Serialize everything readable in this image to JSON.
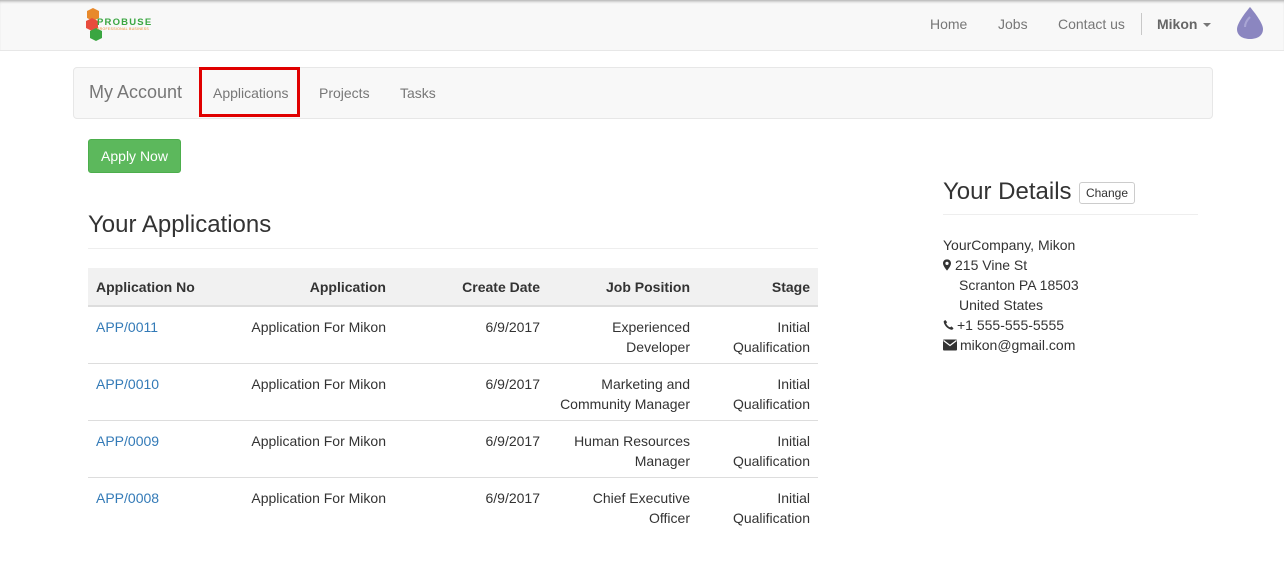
{
  "header": {
    "logo_text": "PROBUSE",
    "logo_tagline": "PROFESSIONAL BUSINESS",
    "nav": [
      "Home",
      "Jobs",
      "Contact us"
    ],
    "user_name": "Mikon"
  },
  "subnav": {
    "brand": "My Account",
    "tabs": [
      "Applications",
      "Projects",
      "Tasks"
    ],
    "active_tab": "Applications"
  },
  "apply_button": "Apply Now",
  "applications": {
    "title": "Your Applications",
    "columns": [
      "Application No",
      "Application",
      "Create Date",
      "Job Position",
      "Stage"
    ],
    "rows": [
      {
        "no": "APP/0011",
        "application": "Application For Mikon",
        "date": "6/9/2017",
        "job_line1": "Experienced",
        "job_line2": "Developer",
        "stage_line1": "Initial",
        "stage_line2": "Qualification"
      },
      {
        "no": "APP/0010",
        "application": "Application For Mikon",
        "date": "6/9/2017",
        "job_line1": "Marketing and",
        "job_line2": "Community Manager",
        "stage_line1": "Initial",
        "stage_line2": "Qualification"
      },
      {
        "no": "APP/0009",
        "application": "Application For Mikon",
        "date": "6/9/2017",
        "job_line1": "Human Resources",
        "job_line2": "Manager",
        "stage_line1": "Initial",
        "stage_line2": "Qualification"
      },
      {
        "no": "APP/0008",
        "application": "Application For Mikon",
        "date": "6/9/2017",
        "job_line1": "Chief Executive",
        "job_line2": "Officer",
        "stage_line1": "Initial",
        "stage_line2": "Qualification"
      }
    ]
  },
  "details": {
    "title": "Your Details",
    "change_button": "Change",
    "company_name": "YourCompany, Mikon",
    "street": "215 Vine St",
    "city_line": "Scranton PA 18503",
    "country": "United States",
    "phone": "+1 555-555-5555",
    "email": "mikon@gmail.com"
  },
  "colors": {
    "highlight_border": "#e00000",
    "apply_button": "#5cb85c",
    "link": "#337ab7",
    "avatar": "#8b86c0"
  },
  "icons": [
    "map-marker-icon",
    "phone-icon",
    "envelope-icon",
    "caret-down-icon"
  ]
}
